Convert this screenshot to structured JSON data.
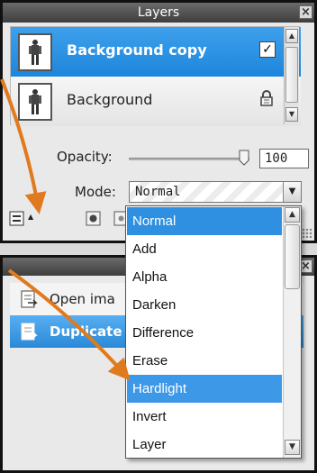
{
  "layers_panel": {
    "title": "Layers",
    "close_glyph": "×",
    "layers": [
      {
        "name": "Background copy",
        "selected": true,
        "status_icon": "checkbox-checked-icon",
        "status_glyph": "✓"
      },
      {
        "name": "Background",
        "selected": false,
        "status_icon": "lock-icon"
      }
    ],
    "opacity_label": "Opacity:",
    "opacity_value": "100",
    "mode_label": "Mode:",
    "mode_value": "Normal"
  },
  "actions_panel": {
    "close_glyph": "×",
    "items": [
      {
        "label": "Open ima",
        "icon": "open-image-icon"
      },
      {
        "label": "Duplicate",
        "icon": "duplicate-icon",
        "selected": true
      }
    ]
  },
  "mode_dropdown": {
    "options": [
      "Normal",
      "Add",
      "Alpha",
      "Darken",
      "Difference",
      "Erase",
      "Hardlight",
      "Invert",
      "Layer"
    ],
    "selected": "Normal",
    "hovered": "Hardlight"
  },
  "colors": {
    "selection_blue": "#1d86db",
    "arrow_orange": "#e07a1e",
    "titlebar_dark": "#3e3e3e"
  }
}
